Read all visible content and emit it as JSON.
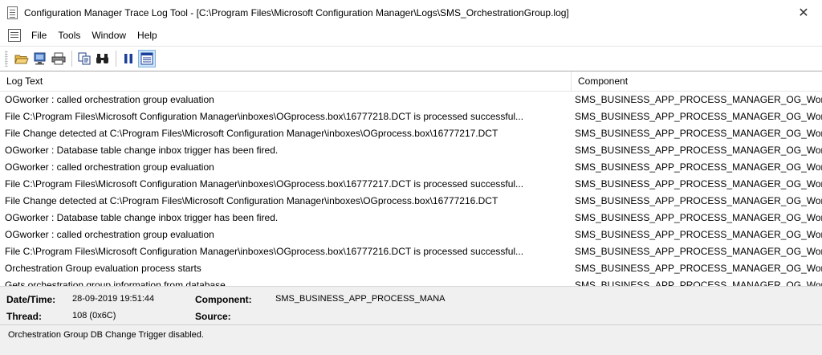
{
  "window": {
    "title": "Configuration Manager Trace Log Tool - [C:\\Program Files\\Microsoft Configuration Manager\\Logs\\SMS_OrchestrationGroup.log]",
    "close_glyph": "✕"
  },
  "menu": {
    "items": [
      "File",
      "Tools",
      "Window",
      "Help"
    ]
  },
  "toolbar": {
    "icons": [
      "open-folder-icon",
      "open-remote-icon",
      "print-icon",
      "copy-icon",
      "find-icon",
      "pause-icon",
      "filter-icon"
    ]
  },
  "grid": {
    "columns": [
      "Log Text",
      "Component"
    ],
    "rows": [
      {
        "log": "OGworker : called orchestration group evaluation",
        "component": "SMS_BUSINESS_APP_PROCESS_MANAGER_OG_Worl"
      },
      {
        "log": "File C:\\Program Files\\Microsoft Configuration Manager\\inboxes\\OGprocess.box\\16777218.DCT is processed successful...",
        "component": "SMS_BUSINESS_APP_PROCESS_MANAGER_OG_Worl"
      },
      {
        "log": "File Change detected at C:\\Program Files\\Microsoft Configuration Manager\\inboxes\\OGprocess.box\\16777217.DCT",
        "component": "SMS_BUSINESS_APP_PROCESS_MANAGER_OG_Worl"
      },
      {
        "log": "OGworker : Database table change inbox trigger has been fired.",
        "component": "SMS_BUSINESS_APP_PROCESS_MANAGER_OG_Worl"
      },
      {
        "log": "OGworker : called orchestration group evaluation",
        "component": "SMS_BUSINESS_APP_PROCESS_MANAGER_OG_Worl"
      },
      {
        "log": "File C:\\Program Files\\Microsoft Configuration Manager\\inboxes\\OGprocess.box\\16777217.DCT is processed successful...",
        "component": "SMS_BUSINESS_APP_PROCESS_MANAGER_OG_Worl"
      },
      {
        "log": "File Change detected at C:\\Program Files\\Microsoft Configuration Manager\\inboxes\\OGprocess.box\\16777216.DCT",
        "component": "SMS_BUSINESS_APP_PROCESS_MANAGER_OG_Worl"
      },
      {
        "log": "OGworker : Database table change inbox trigger has been fired.",
        "component": "SMS_BUSINESS_APP_PROCESS_MANAGER_OG_Worl"
      },
      {
        "log": "OGworker : called orchestration group evaluation",
        "component": "SMS_BUSINESS_APP_PROCESS_MANAGER_OG_Worl"
      },
      {
        "log": "File C:\\Program Files\\Microsoft Configuration Manager\\inboxes\\OGprocess.box\\16777216.DCT is processed successful...",
        "component": "SMS_BUSINESS_APP_PROCESS_MANAGER_OG_Worl"
      },
      {
        "log": "Orchestration Group evaluation process starts",
        "component": "SMS_BUSINESS_APP_PROCESS_MANAGER_OG_Worl"
      },
      {
        "log": "Gets orchestration group information from database",
        "component": "SMS_BUSINESS_APP_PROCESS_MANAGER_OG_Worl"
      }
    ]
  },
  "details": {
    "datetime_label": "Date/Time:",
    "datetime_value": "28-09-2019 19:51:44",
    "component_label": "Component:",
    "component_value": "SMS_BUSINESS_APP_PROCESS_MANA",
    "thread_label": "Thread:",
    "thread_value": "108 (0x6C)",
    "source_label": "Source:",
    "source_value": ""
  },
  "message": {
    "text": "Orchestration Group DB Change Trigger disabled."
  }
}
